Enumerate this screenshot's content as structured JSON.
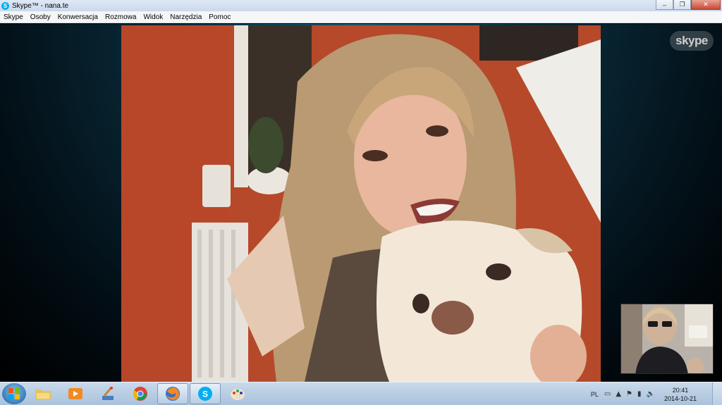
{
  "window": {
    "title": "Skype™ - nana.te",
    "app_icon_letter": "S",
    "controls": {
      "minimize": "–",
      "maximize": "❐",
      "close": "✕"
    }
  },
  "menu": [
    "Skype",
    "Osoby",
    "Konwersacja",
    "Rozmowa",
    "Widok",
    "Narzędzia",
    "Pomoc"
  ],
  "call": {
    "watermark": "skype"
  },
  "taskbar": {
    "apps": [
      {
        "name": "explorer",
        "icon": "folder-icon"
      },
      {
        "name": "media-player",
        "icon": "media-player-icon"
      },
      {
        "name": "paint-app",
        "icon": "paint-brush-icon"
      },
      {
        "name": "chrome",
        "icon": "chrome-icon"
      },
      {
        "name": "firefox",
        "icon": "firefox-icon"
      },
      {
        "name": "skype",
        "icon": "skype-icon"
      },
      {
        "name": "paint",
        "icon": "palette-icon"
      }
    ],
    "language": "PL",
    "clock": {
      "time": "20:41",
      "date": "2014-10-21"
    }
  },
  "colors": {
    "skype_blue": "#00aff0",
    "call_background": "#0a2e3d"
  }
}
